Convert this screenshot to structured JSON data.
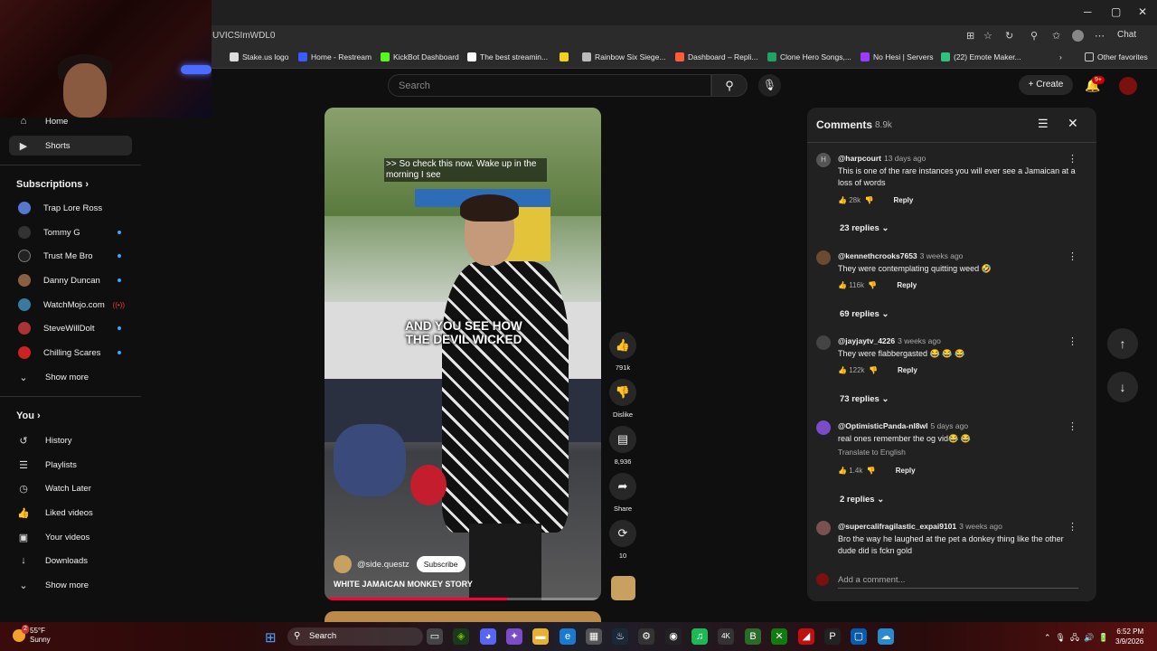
{
  "browser": {
    "url": "UVICSImWDL0",
    "chat_label": "Chat",
    "bookmarks": [
      {
        "label": "Stake.us logo",
        "color": "#dddddd"
      },
      {
        "label": "Home - Restream",
        "color": "#3b5bff"
      },
      {
        "label": "KickBot Dashboard",
        "color": "#53fc18"
      },
      {
        "label": "The best streamin...",
        "color": "#ffffff"
      },
      {
        "label": "",
        "color": "#f2d21b"
      },
      {
        "label": "Rainbow Six Siege...",
        "color": "#bbbbbb"
      },
      {
        "label": "Dashboard – Repli...",
        "color": "#ff5a3a"
      },
      {
        "label": "Clone Hero Songs,...",
        "color": "#1fa463"
      },
      {
        "label": "No Hesi | Servers",
        "color": "#9b3bff"
      },
      {
        "label": "(22) Emote Maker...",
        "color": "#2ec27e"
      }
    ],
    "other_favorites": "Other favorites"
  },
  "youtube": {
    "search_placeholder": "Search",
    "create_label": "Create",
    "notif_badge": "9+"
  },
  "sidebar": {
    "top": [
      {
        "label": "Home",
        "icon": "home-icon"
      },
      {
        "label": "Shorts",
        "icon": "shorts-icon"
      }
    ],
    "subscriptions_title": "Subscriptions",
    "subscriptions": [
      {
        "label": "Trap Lore Ross",
        "color": "#5577cc",
        "live": false
      },
      {
        "label": "Tommy G",
        "color": "#333333",
        "live": false
      },
      {
        "label": "Trust Me Bro",
        "color": "#222222",
        "live": false
      },
      {
        "label": "Danny Duncan",
        "color": "#8a6040",
        "live": false
      },
      {
        "label": "WatchMojo.com",
        "color": "#3a7aa0",
        "live": true
      },
      {
        "label": "SteveWillDolt",
        "color": "#aa3333",
        "live": false
      },
      {
        "label": "Chilling Scares",
        "color": "#cc2222",
        "live": false
      }
    ],
    "show_more": "Show more",
    "you_title": "You",
    "you_items": [
      {
        "label": "History",
        "icon": "history-icon"
      },
      {
        "label": "Playlists",
        "icon": "playlists-icon"
      },
      {
        "label": "Watch Later",
        "icon": "watch-later-icon"
      },
      {
        "label": "Liked videos",
        "icon": "liked-icon"
      },
      {
        "label": "Your videos",
        "icon": "your-videos-icon"
      },
      {
        "label": "Downloads",
        "icon": "downloads-icon"
      }
    ],
    "show_more_2": "Show more"
  },
  "short": {
    "caption_top": ">> So check this now. Wake up in the morning I see",
    "caption_main": "AND YOU SEE HOW THE DEVIL WICKED",
    "channel": "@side.questz",
    "subscribe": "Subscribe",
    "title": "WHITE JAMAICAN MONKEY STORY",
    "progress_fraction": 0.66
  },
  "actions": {
    "likes": "791k",
    "dislike": "Dislike",
    "comments": "8,936",
    "share": "Share",
    "remix": "10"
  },
  "comments_panel": {
    "title": "Comments",
    "count": "8.9k",
    "reply_label": "Reply",
    "add_placeholder": "Add a comment...",
    "items": [
      {
        "author": "@harpcourt",
        "ago": "13 days ago",
        "text": "This is one of the rare instances you will ever see a Jamaican at a loss of words",
        "likes": "28k",
        "replies": "23 replies",
        "translate": "",
        "avatar": "#555555",
        "initial": "H"
      },
      {
        "author": "@kennethcrooks7653",
        "ago": "3 weeks ago",
        "text": "They were contemplating quitting weed 🤣",
        "likes": "116k",
        "replies": "69 replies",
        "translate": "",
        "avatar": "#6a4a30",
        "initial": ""
      },
      {
        "author": "@jayjaytv_4226",
        "ago": "3 weeks ago",
        "text": "They were flabbergasted 😂 😂 😂",
        "likes": "122k",
        "replies": "73 replies",
        "translate": "",
        "avatar": "#444444",
        "initial": ""
      },
      {
        "author": "@OptimisticPanda-nl8wl",
        "ago": "5 days ago",
        "text": "real ones remember the og vid😂 😂",
        "likes": "1.4k",
        "replies": "2 replies",
        "translate": "Translate to English",
        "avatar": "#7a4cc8",
        "initial": ""
      },
      {
        "author": "@supercalifragilastic_expai9101",
        "ago": "3 weeks ago",
        "text": "Bro the way he laughed at the pet a donkey thing like the other dude did is fckn gold",
        "likes": "",
        "replies": "",
        "translate": "",
        "avatar": "#7a5050",
        "initial": ""
      }
    ]
  },
  "taskbar": {
    "temp": "55°F",
    "condition": "Sunny",
    "weather_badge": "2",
    "search": "Search",
    "time": "6:52 PM",
    "date": "3/9/2026"
  }
}
